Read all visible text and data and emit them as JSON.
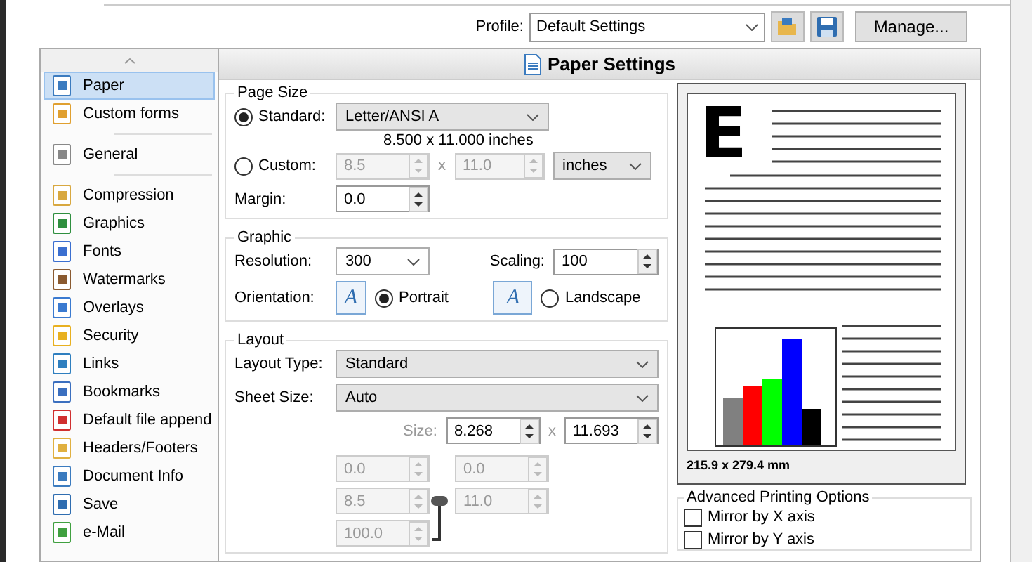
{
  "toolbar": {
    "profile_label": "Profile:",
    "profile_value": "Default Settings",
    "manage_button": "Manage..."
  },
  "sidebar": {
    "items": [
      {
        "label": "Paper",
        "selected": true,
        "separator_after": false
      },
      {
        "label": "Custom forms",
        "selected": false,
        "separator_after": true
      },
      {
        "label": "General",
        "selected": false,
        "separator_after": true
      },
      {
        "label": "Compression",
        "selected": false,
        "separator_after": false
      },
      {
        "label": "Graphics",
        "selected": false,
        "separator_after": false
      },
      {
        "label": "Fonts",
        "selected": false,
        "separator_after": false
      },
      {
        "label": "Watermarks",
        "selected": false,
        "separator_after": false
      },
      {
        "label": "Overlays",
        "selected": false,
        "separator_after": false
      },
      {
        "label": "Security",
        "selected": false,
        "separator_after": false
      },
      {
        "label": "Links",
        "selected": false,
        "separator_after": false
      },
      {
        "label": "Bookmarks",
        "selected": false,
        "separator_after": false
      },
      {
        "label": "Default file append",
        "selected": false,
        "separator_after": false
      },
      {
        "label": "Headers/Footers",
        "selected": false,
        "separator_after": false
      },
      {
        "label": "Document Info",
        "selected": false,
        "separator_after": false
      },
      {
        "label": "Save",
        "selected": false,
        "separator_after": false
      },
      {
        "label": "e-Mail",
        "selected": false,
        "separator_after": false
      }
    ]
  },
  "panel_title": "Paper Settings",
  "page_size": {
    "title": "Page Size",
    "options": [
      {
        "label": "Standard:",
        "selected": true
      },
      {
        "label": "Custom:",
        "selected": false
      }
    ],
    "standard_value": "Letter/ANSI A",
    "dimensions": "8.500 x 11.000 inches",
    "custom_width": {
      "value": "8.5",
      "disabled": true
    },
    "times": "x",
    "custom_height": {
      "value": "11.0",
      "disabled": true
    },
    "units": "inches",
    "margin_label": "Margin:",
    "margin": {
      "value": "0.0",
      "disabled": false
    }
  },
  "graphic": {
    "title": "Graphic",
    "resolution_label": "Resolution:",
    "resolution": "300",
    "scaling_label": "Scaling:",
    "scaling": {
      "value": "100",
      "disabled": false
    },
    "orientation_label": "Orientation:",
    "orientations": [
      {
        "label": "Portrait",
        "icon_glyph": "A",
        "selected": true
      },
      {
        "label": "Landscape",
        "icon_glyph": "A",
        "selected": false
      }
    ]
  },
  "layout": {
    "title": "Layout",
    "layout_type_label": "Layout Type:",
    "layout_type": "Standard",
    "sheet_size_label": "Sheet Size:",
    "sheet_size": "Auto",
    "size_label": "Size:",
    "size_width": {
      "value": "8.268",
      "disabled": false
    },
    "times": "x",
    "size_height": {
      "value": "11.693",
      "disabled": false
    },
    "grid": [
      {
        "value": "0.0",
        "disabled": true
      },
      {
        "value": "0.0",
        "disabled": true
      },
      {
        "value": "8.5",
        "disabled": true
      },
      {
        "value": "11.0",
        "disabled": true
      },
      {
        "value": "100.0",
        "disabled": true
      }
    ]
  },
  "preview": {
    "glyph": "E",
    "caption": "215.9 x 279.4 mm"
  },
  "advanced": {
    "title": "Advanced Printing Options",
    "options": [
      {
        "label": "Mirror by X axis",
        "checked": false
      },
      {
        "label": "Mirror by Y axis",
        "checked": false
      }
    ]
  }
}
